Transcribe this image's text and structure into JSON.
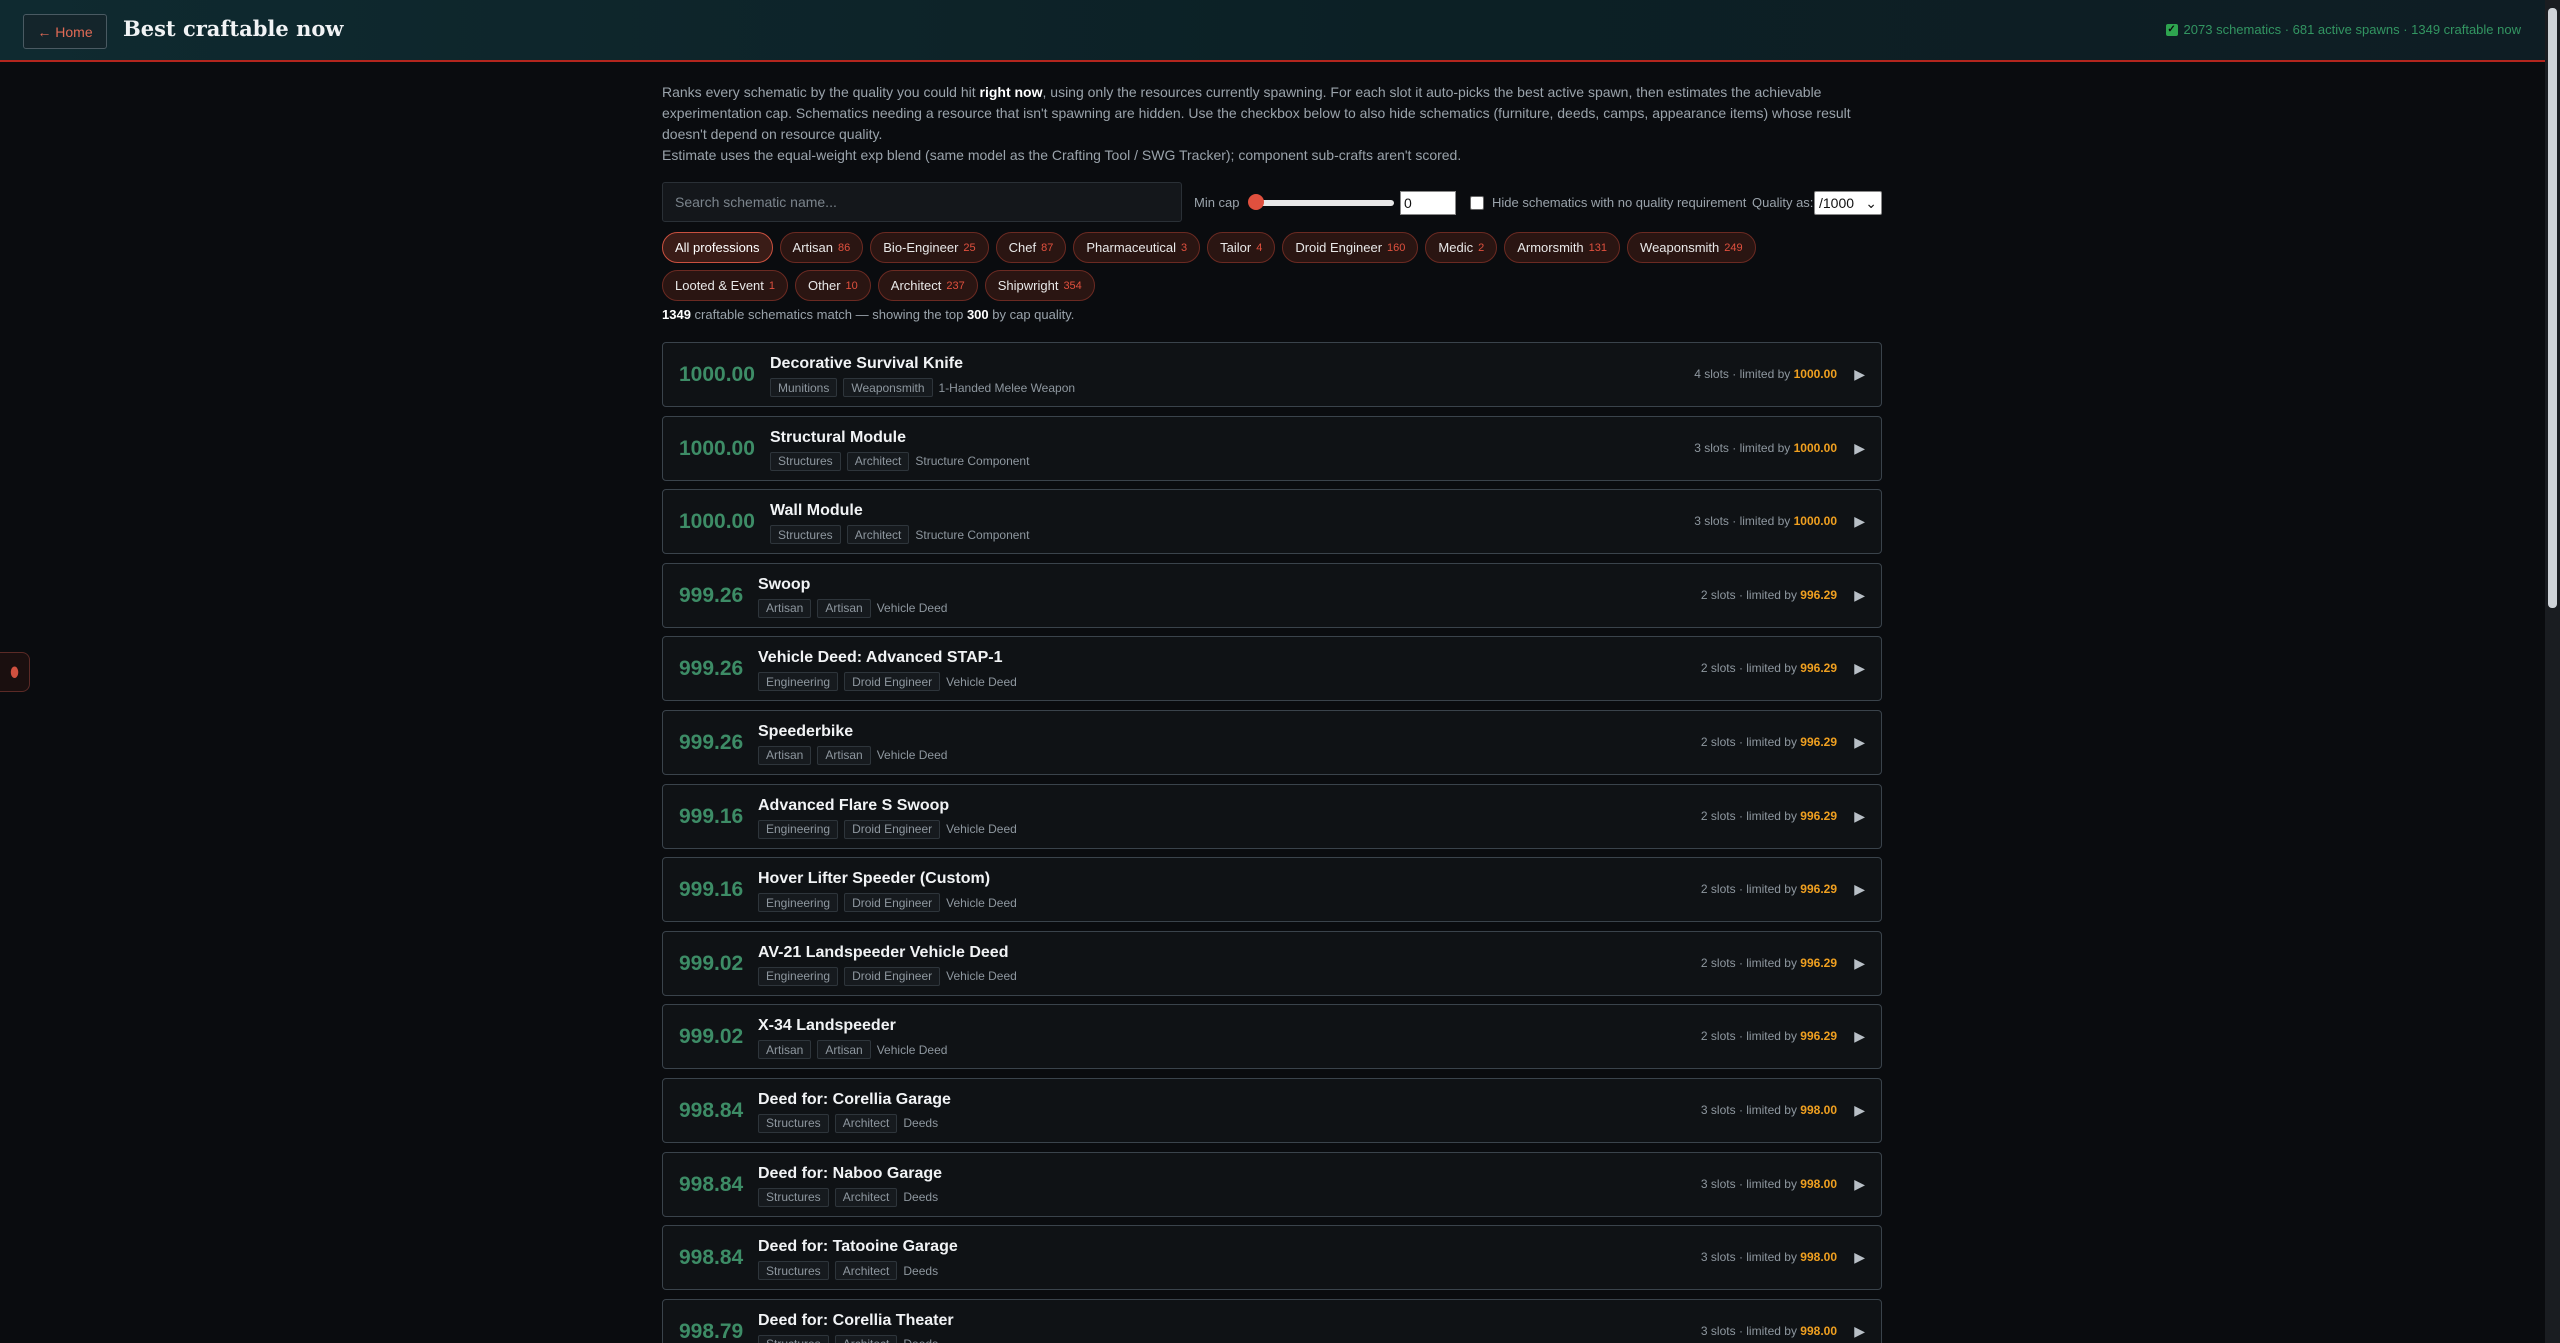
{
  "header": {
    "home_label": "← Home",
    "title": "Best craftable now",
    "status": "2073 schematics · 681 active spawns · 1349 craftable now"
  },
  "description": {
    "p1_a": "Ranks every schematic by the quality you could hit ",
    "p1_b": "right now",
    "p1_c": ", using only the resources currently spawning. For each slot it auto-picks the best active spawn, then estimates the achievable experimentation cap. Schematics needing a resource that isn't spawning are hidden. Use the checkbox below to also hide schematics (furniture, deeds, camps, appearance items) whose result doesn't depend on resource quality.",
    "p2": "Estimate uses the equal-weight exp blend (same model as the Crafting Tool / SWG Tracker); component sub-crafts aren't scored."
  },
  "controls": {
    "search_placeholder": "Search schematic name...",
    "min_cap_label": "Min cap",
    "min_cap_value": "0",
    "min_cap_fraction": 0,
    "hide_label": "Hide schematics with no quality requirement",
    "hide_checked": false,
    "quality_label": "Quality as:",
    "quality_value": "/1000"
  },
  "chips_row1": [
    {
      "label": "All professions",
      "count": "",
      "active": true
    },
    {
      "label": "Artisan",
      "count": "86"
    },
    {
      "label": "Bio-Engineer",
      "count": "25"
    },
    {
      "label": "Chef",
      "count": "87"
    },
    {
      "label": "Pharmaceutical",
      "count": "3"
    },
    {
      "label": "Tailor",
      "count": "4"
    },
    {
      "label": "Droid Engineer",
      "count": "160"
    },
    {
      "label": "Medic",
      "count": "2"
    },
    {
      "label": "Armorsmith",
      "count": "131"
    },
    {
      "label": "Weaponsmith",
      "count": "249"
    }
  ],
  "chips_row2": [
    {
      "label": "Looted & Event",
      "count": "1"
    },
    {
      "label": "Other",
      "count": "10"
    },
    {
      "label": "Architect",
      "count": "237"
    },
    {
      "label": "Shipwright",
      "count": "354"
    }
  ],
  "match": {
    "count": "1349",
    "middle": " craftable schematics match — showing the top ",
    "top": "300",
    "end": " by cap quality."
  },
  "results": [
    {
      "score": "1000.00",
      "name": "Decorative Survival Knife",
      "tags": [
        "Munitions",
        "Weaponsmith"
      ],
      "type": "1-Handed Melee Weapon",
      "slots": "4 slots · limited by ",
      "limit": "1000.00"
    },
    {
      "score": "1000.00",
      "name": "Structural Module",
      "tags": [
        "Structures",
        "Architect"
      ],
      "type": "Structure Component",
      "slots": "3 slots · limited by ",
      "limit": "1000.00"
    },
    {
      "score": "1000.00",
      "name": "Wall Module",
      "tags": [
        "Structures",
        "Architect"
      ],
      "type": "Structure Component",
      "slots": "3 slots · limited by ",
      "limit": "1000.00"
    },
    {
      "score": "999.26",
      "name": "Swoop",
      "tags": [
        "Artisan",
        "Artisan"
      ],
      "type": "Vehicle Deed",
      "slots": "2 slots · limited by ",
      "limit": "996.29"
    },
    {
      "score": "999.26",
      "name": "Vehicle Deed: Advanced STAP-1",
      "tags": [
        "Engineering",
        "Droid Engineer"
      ],
      "type": "Vehicle Deed",
      "slots": "2 slots · limited by ",
      "limit": "996.29"
    },
    {
      "score": "999.26",
      "name": "Speederbike",
      "tags": [
        "Artisan",
        "Artisan"
      ],
      "type": "Vehicle Deed",
      "slots": "2 slots · limited by ",
      "limit": "996.29"
    },
    {
      "score": "999.16",
      "name": "Advanced Flare S Swoop",
      "tags": [
        "Engineering",
        "Droid Engineer"
      ],
      "type": "Vehicle Deed",
      "slots": "2 slots · limited by ",
      "limit": "996.29"
    },
    {
      "score": "999.16",
      "name": "Hover Lifter Speeder (Custom)",
      "tags": [
        "Engineering",
        "Droid Engineer"
      ],
      "type": "Vehicle Deed",
      "slots": "2 slots · limited by ",
      "limit": "996.29"
    },
    {
      "score": "999.02",
      "name": "AV-21 Landspeeder Vehicle Deed",
      "tags": [
        "Engineering",
        "Droid Engineer"
      ],
      "type": "Vehicle Deed",
      "slots": "2 slots · limited by ",
      "limit": "996.29"
    },
    {
      "score": "999.02",
      "name": "X-34 Landspeeder",
      "tags": [
        "Artisan",
        "Artisan"
      ],
      "type": "Vehicle Deed",
      "slots": "2 slots · limited by ",
      "limit": "996.29"
    },
    {
      "score": "998.84",
      "name": "Deed for: Corellia Garage",
      "tags": [
        "Structures",
        "Architect"
      ],
      "type": "Deeds",
      "slots": "3 slots · limited by ",
      "limit": "998.00"
    },
    {
      "score": "998.84",
      "name": "Deed for: Naboo Garage",
      "tags": [
        "Structures",
        "Architect"
      ],
      "type": "Deeds",
      "slots": "3 slots · limited by ",
      "limit": "998.00"
    },
    {
      "score": "998.84",
      "name": "Deed for: Tatooine Garage",
      "tags": [
        "Structures",
        "Architect"
      ],
      "type": "Deeds",
      "slots": "3 slots · limited by ",
      "limit": "998.00"
    },
    {
      "score": "998.79",
      "name": "Deed for: Corellia Theater",
      "tags": [
        "Structures",
        "Architect"
      ],
      "type": "Deeds",
      "slots": "3 slots · limited by ",
      "limit": "998.00"
    }
  ],
  "colors": {
    "accent_red": "#e0503e",
    "score_green": "#3d8c66",
    "limit_orange": "#f0a020"
  }
}
